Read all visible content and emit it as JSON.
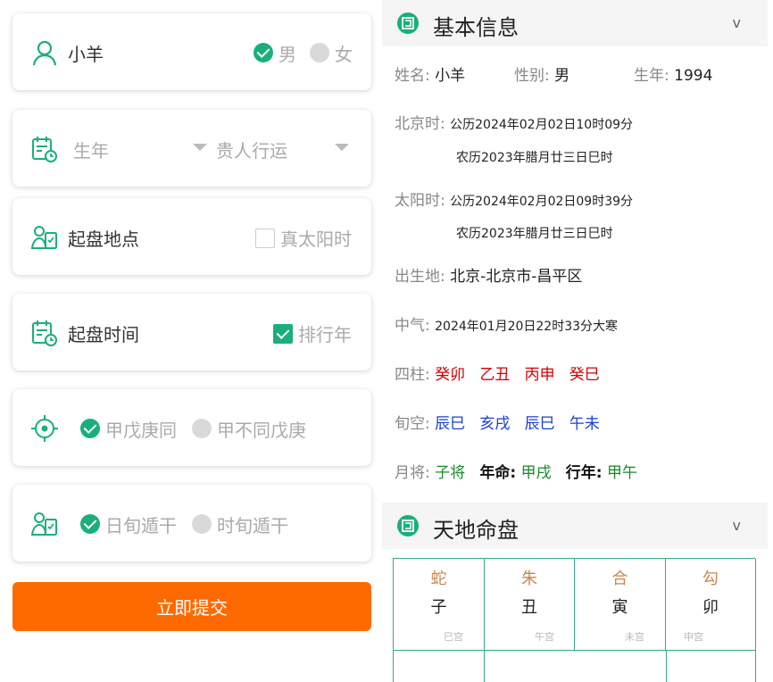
{
  "form": {
    "name": "小羊",
    "gender_options": [
      "男",
      "女"
    ],
    "gender_selected": "男",
    "birth_year_placeholder": "生年",
    "luck_placeholder": "贵人行运",
    "location_label": "起盘地点",
    "true_solar_label": "真太阳时",
    "true_solar_checked": false,
    "time_label": "起盘时间",
    "year_order_label": "排行年",
    "year_order_checked": true,
    "option_a1": "甲戊庚同",
    "option_a2": "甲不同戊庚",
    "option_a_selected": "甲戊庚同",
    "option_b1": "日旬遁干",
    "option_b2": "时旬遁干",
    "option_b_selected": "日旬遁干",
    "submit_label": "立即提交"
  },
  "basic_info": {
    "title": "基本信息",
    "chevron": "v",
    "name_label": "姓名:",
    "name_value": "小羊",
    "gender_label": "性别:",
    "gender_value": "男",
    "year_label": "生年:",
    "year_value": "1994",
    "beijing_label": "北京时:",
    "beijing_solar": "公历2024年02月02日10时09分",
    "beijing_lunar": "农历2023年腊月廿三日巳时",
    "sun_label": "太阳时:",
    "sun_solar": "公历2024年02月02日09时39分",
    "sun_lunar": "农历2023年腊月廿三日巳时",
    "birthplace_label": "出生地:",
    "birthplace_value": "北京-北京市-昌平区",
    "qi_label": "中气:",
    "qi_value": "2024年01月20日22时33分大寒",
    "pillars_label": "四柱:",
    "pillars": [
      "癸卯",
      "乙丑",
      "丙申",
      "癸巳"
    ],
    "xunkong_label": "旬空:",
    "xunkong": [
      "辰巳",
      "亥戌",
      "辰巳",
      "午未"
    ],
    "yuejiang_label": "月将:",
    "yuejiang_value": "子将",
    "nianming_label": "年命:",
    "nianming_value": "甲戌",
    "xingnian_label": "行年:",
    "xingnian_value": "甲午"
  },
  "chart": {
    "title": "天地命盘",
    "chevron": "v",
    "cells": [
      {
        "god": "蛇",
        "branch": "子",
        "palace": "巳宫"
      },
      {
        "god": "朱",
        "branch": "丑",
        "palace": "午宫"
      },
      {
        "god": "合",
        "branch": "寅",
        "palace": "未宫"
      },
      {
        "god": "勾",
        "branch": "卯",
        "palace": "申宫"
      }
    ]
  },
  "colors": {
    "accent_green": "#1aaf7a",
    "submit_orange": "#ff6a00",
    "pillar_red": "#d40000",
    "xunkong_blue": "#1a3fd0",
    "yuejiang_green": "#1a8a2a"
  }
}
